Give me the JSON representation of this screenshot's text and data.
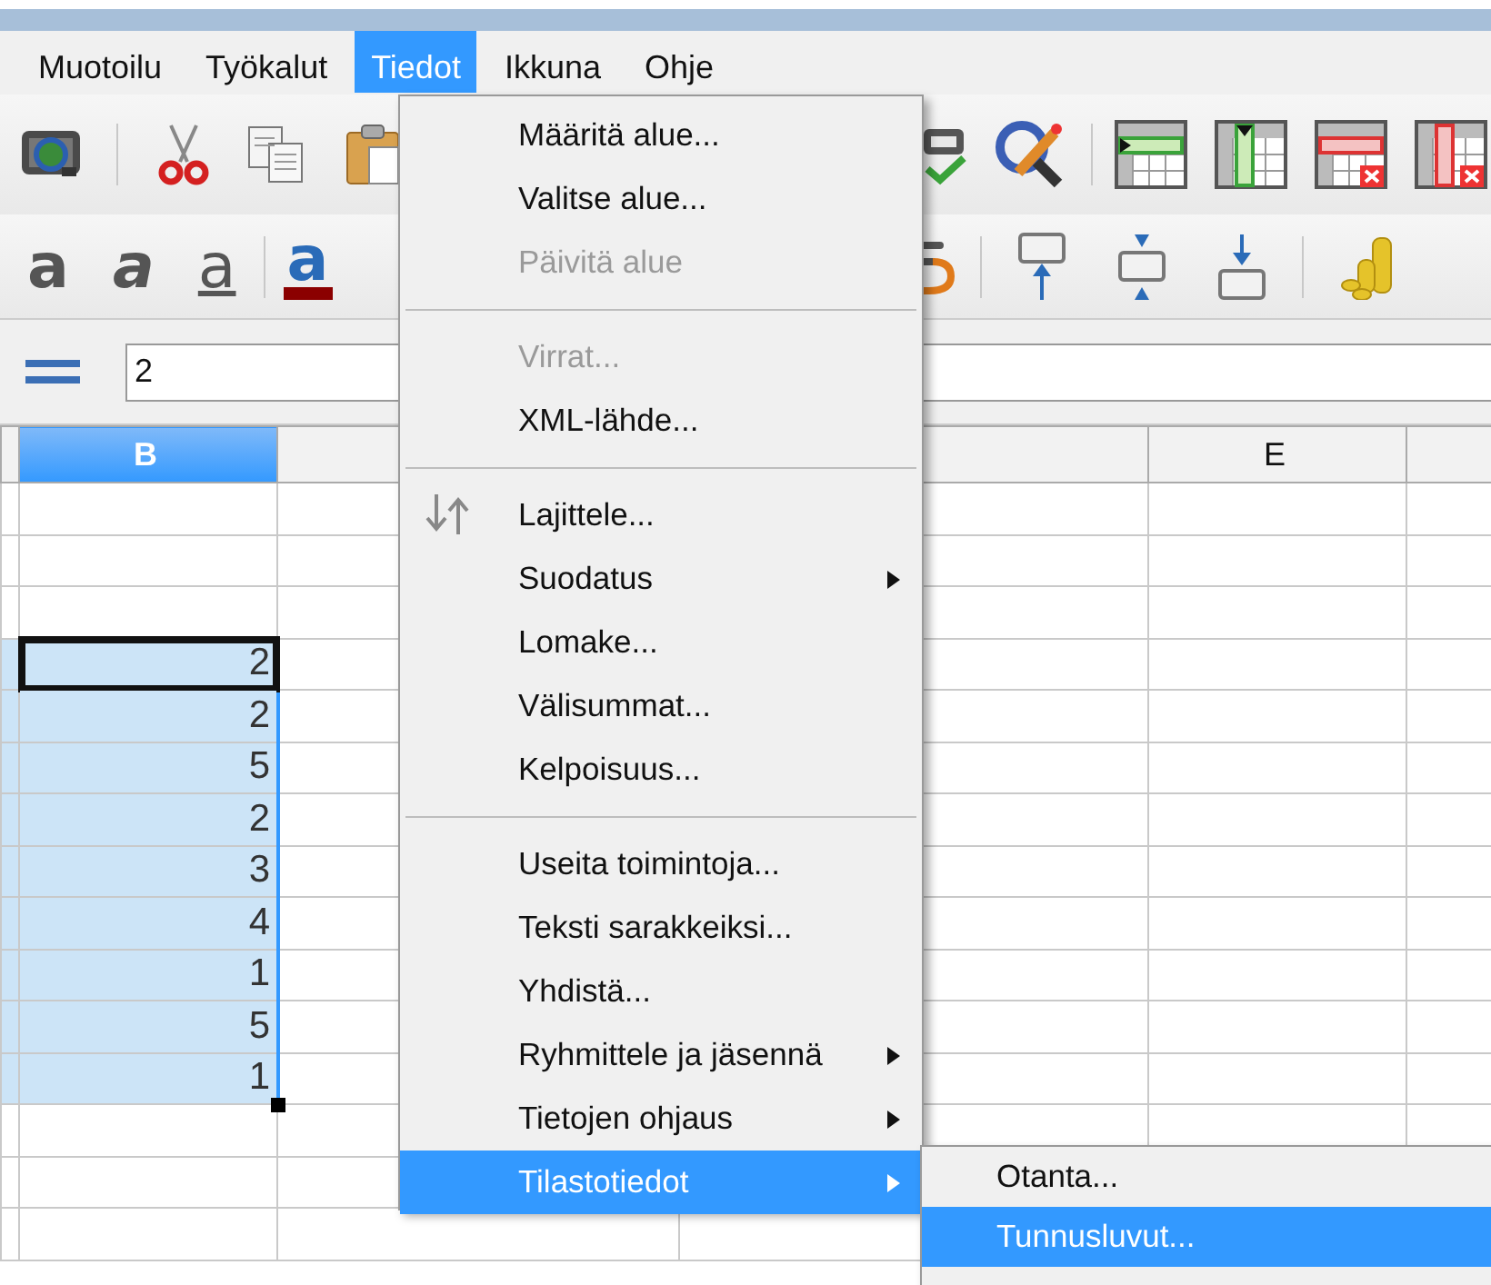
{
  "menu_bar": [
    {
      "label": "Muotoilu",
      "selected": false
    },
    {
      "label": "Työkalut",
      "selected": false
    },
    {
      "label": "Tiedot",
      "selected": true
    },
    {
      "label": "Ikkuna",
      "selected": false
    },
    {
      "label": "Ohje",
      "selected": false
    }
  ],
  "format_toolbar": [
    {
      "glyph": "a",
      "kind": "bold"
    },
    {
      "glyph": "a",
      "kind": "italic"
    },
    {
      "glyph": "a",
      "kind": "underline"
    },
    {
      "glyph": "a",
      "kind": "font_color"
    }
  ],
  "formula_bar": {
    "value": "2"
  },
  "sheet": {
    "columns": [
      {
        "selected": true,
        "label": "B"
      },
      {
        "selected": false
      },
      {
        "selected": false
      },
      {
        "selected": false,
        "label": "E"
      },
      {
        "selected": false
      }
    ],
    "column_b_cells": [
      {
        "selected": false,
        "active": false
      },
      {
        "selected": false,
        "active": false
      },
      {
        "selected": false,
        "active": false
      },
      {
        "value": "2",
        "selected": true,
        "active": true
      },
      {
        "value": "2",
        "selected": true,
        "active": false
      },
      {
        "value": "5",
        "selected": true,
        "active": false
      },
      {
        "value": "2",
        "selected": true,
        "active": false
      },
      {
        "value": "3",
        "selected": true,
        "active": false
      },
      {
        "value": "4",
        "selected": true,
        "active": false
      },
      {
        "value": "1",
        "selected": true,
        "active": false
      },
      {
        "value": "5",
        "selected": true,
        "active": false
      },
      {
        "value": "1",
        "selected": true,
        "active": false
      },
      {
        "selected": false,
        "active": false
      },
      {
        "selected": false,
        "active": false
      },
      {
        "selected": false,
        "active": false
      }
    ]
  },
  "data_menu": [
    {
      "kind": "item",
      "label": "Määritä alue...",
      "disabled": false,
      "submenu": false,
      "selected": false
    },
    {
      "kind": "item",
      "label": "Valitse alue...",
      "disabled": false,
      "submenu": false,
      "selected": false
    },
    {
      "kind": "item",
      "label": "Päivitä alue",
      "disabled": true,
      "submenu": false,
      "selected": false
    },
    {
      "kind": "separator"
    },
    {
      "kind": "item",
      "label": "Virrat...",
      "disabled": true,
      "submenu": false,
      "selected": false
    },
    {
      "kind": "item",
      "label": "XML-lähde...",
      "disabled": false,
      "submenu": false,
      "selected": false
    },
    {
      "kind": "separator"
    },
    {
      "kind": "icon_item",
      "label": "Lajittele...",
      "disabled": false,
      "submenu": false,
      "selected": false
    },
    {
      "kind": "item",
      "label": "Suodatus",
      "disabled": false,
      "submenu": true,
      "selected": false
    },
    {
      "kind": "item",
      "label": "Lomake...",
      "disabled": false,
      "submenu": false,
      "selected": false
    },
    {
      "kind": "item",
      "label": "Välisummat...",
      "disabled": false,
      "submenu": false,
      "selected": false
    },
    {
      "kind": "item",
      "label": "Kelpoisuus...",
      "disabled": false,
      "submenu": false,
      "selected": false
    },
    {
      "kind": "separator"
    },
    {
      "kind": "item",
      "label": "Useita toimintoja...",
      "disabled": false,
      "submenu": false,
      "selected": false
    },
    {
      "kind": "item",
      "label": "Teksti sarakkeiksi...",
      "disabled": false,
      "submenu": false,
      "selected": false
    },
    {
      "kind": "item",
      "label": "Yhdistä...",
      "disabled": false,
      "submenu": false,
      "selected": false
    },
    {
      "kind": "item",
      "label": "Ryhmittele ja jäsennä",
      "disabled": false,
      "submenu": true,
      "selected": false
    },
    {
      "kind": "item",
      "label": "Tietojen ohjaus",
      "disabled": false,
      "submenu": true,
      "selected": false
    },
    {
      "kind": "item",
      "label": "Tilastotiedot",
      "disabled": false,
      "submenu": true,
      "selected": true
    }
  ],
  "statistics_submenu": [
    {
      "label": "Otanta...",
      "selected": false
    },
    {
      "label": "Tunnusluvut...",
      "selected": true
    }
  ]
}
